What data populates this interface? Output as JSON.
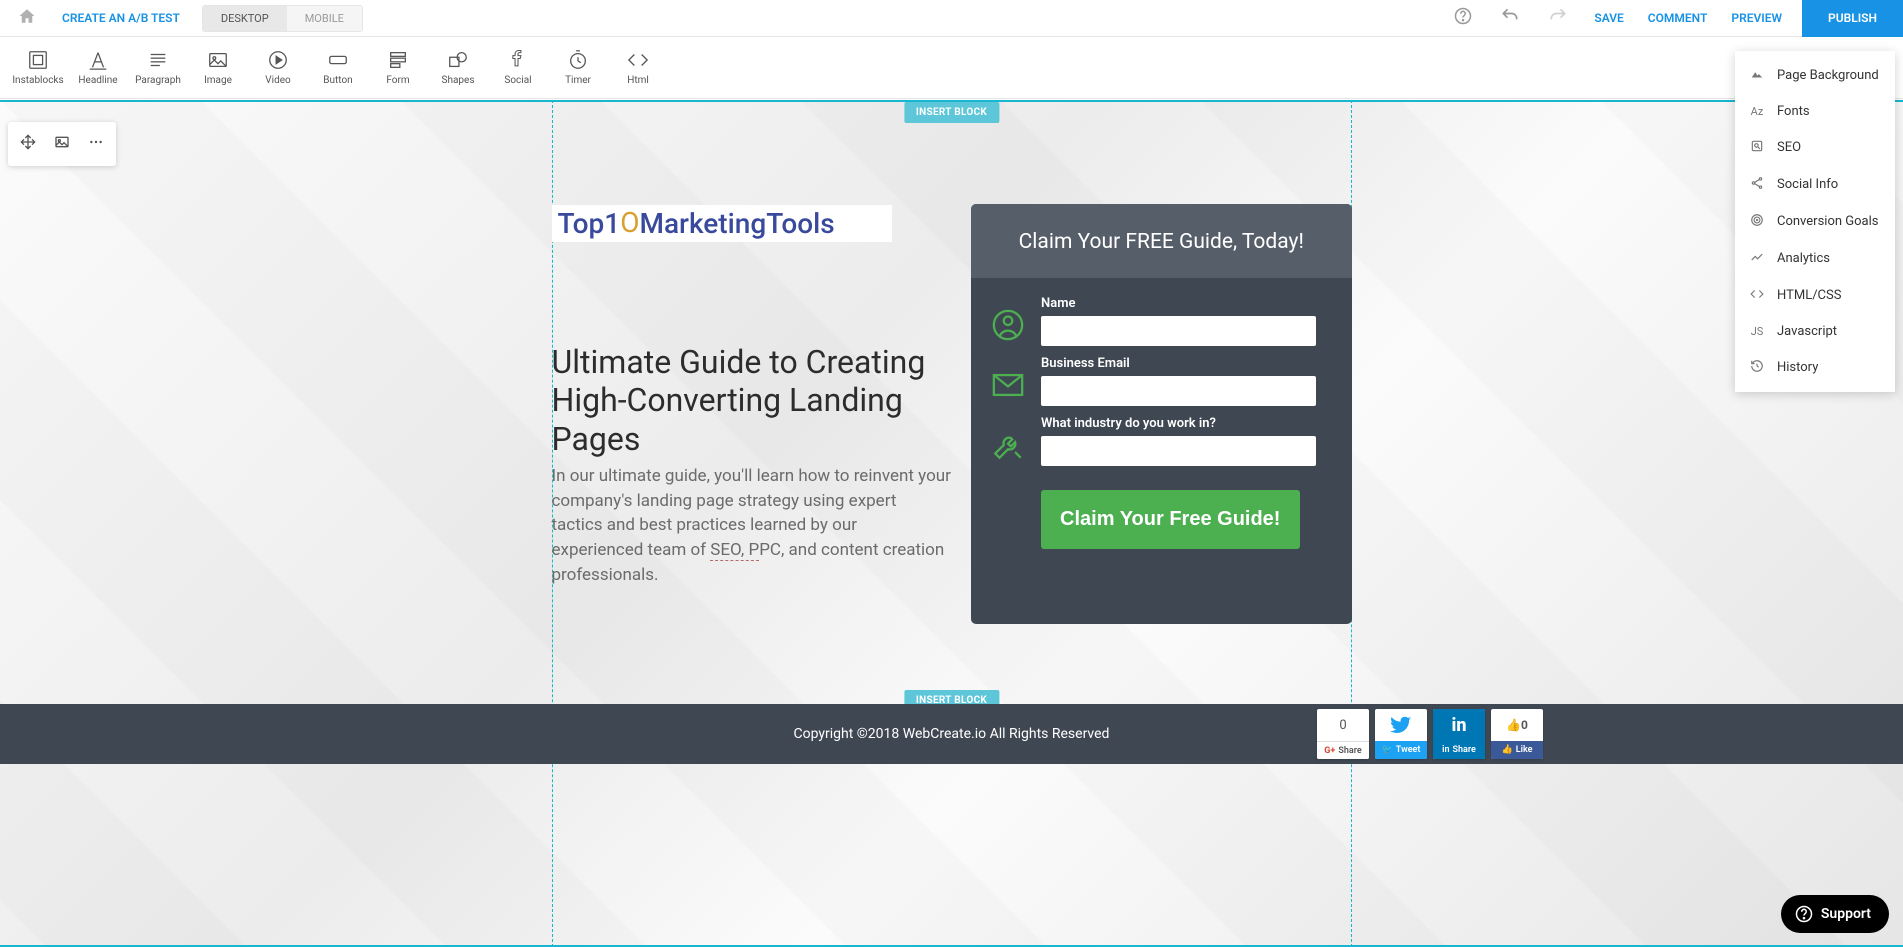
{
  "topbar": {
    "ab_test": "CREATE AN A/B TEST",
    "desktop": "DESKTOP",
    "mobile": "MOBILE",
    "save": "SAVE",
    "comment": "COMMENT",
    "preview": "PREVIEW",
    "publish": "PUBLISH"
  },
  "elements": {
    "instablocks": "Instablocks",
    "headline": "Headline",
    "paragraph": "Paragraph",
    "image": "Image",
    "video": "Video",
    "button": "Button",
    "form": "Form",
    "shapes": "Shapes",
    "social": "Social",
    "timer": "Timer",
    "html": "Html"
  },
  "canvas": {
    "insert_block": "INSERT BLOCK"
  },
  "logo": {
    "part1": "Top1",
    "circle": "O",
    "part2": "MarketingTools"
  },
  "hero": {
    "title": "Ultimate Guide to Creating High-Converting Landing Pages",
    "body_prefix": "In our ultimate guide, you'll learn how to reinvent your company's landing page strategy using expert tactics and best practices learned by our experienced team of ",
    "seo": "SEO, P",
    "body_mid": "PC",
    "body_suffix": ", and content creation professionals."
  },
  "form": {
    "heading": "Claim Your FREE Guide, Today!",
    "name_label": "Name",
    "email_label": "Business Email",
    "industry_label": "What industry do you work in?",
    "submit": "Claim Your Free Guide!"
  },
  "footer": {
    "copyright": "Copyright ©2018 WebCreate.io All Rights Reserved"
  },
  "social": {
    "gcount": "0",
    "gshare": "Share",
    "tweet": "Tweet",
    "lishare": "Share",
    "fbcount": "0",
    "fblike": "Like"
  },
  "settings": {
    "page_background": "Page Background",
    "fonts": "Fonts",
    "seo": "SEO",
    "social_info": "Social Info",
    "conversion_goals": "Conversion Goals",
    "analytics": "Analytics",
    "html_css": "HTML/CSS",
    "javascript": "Javascript",
    "history": "History",
    "icon_fonts": "Az",
    "icon_js": "JS"
  },
  "support": {
    "label": "Support"
  }
}
